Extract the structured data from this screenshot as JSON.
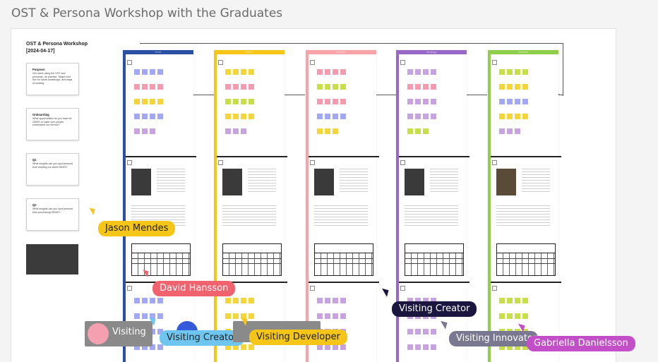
{
  "page_title": "OST & Persona Workshop with the Graduates",
  "workshop": {
    "title_line1": "OST & Persona Workshop",
    "title_line2": "[2024-04-17]",
    "cards": [
      {
        "heading": "Purpose:",
        "text": "Get users using the OST and personas, do practice. Target next five for future workshops, and ways of working"
      },
      {
        "heading": "Onboarding",
        "text": "What opportunities do you have for OEMS to make sure people understand our service?"
      },
      {
        "heading": "Q1",
        "text": "What insights can you spot persona from building our client OEMS?"
      },
      {
        "heading": "Q2",
        "text": "What insights can you spot persona from purchasing OEMS?"
      }
    ]
  },
  "columns": [
    {
      "name": "Rolls",
      "color": "#2b4fa3"
    },
    {
      "name": "Vision",
      "color": "#f5c518"
    },
    {
      "name": "Monitor",
      "color": "#f7a3a8"
    },
    {
      "name": "Strategy",
      "color": "#9868c7"
    },
    {
      "name": "Valuable",
      "color": "#8fce4a"
    }
  ],
  "sticky_colors": {
    "blue": "#a3a8f5",
    "yellow": "#f5d63a",
    "pink": "#f59bb0",
    "purple": "#c7a3e0",
    "green": "#c7e04a"
  },
  "collaborators": [
    {
      "name": "Jason Mendes",
      "color": "#f5c518",
      "text_color": "#222222"
    },
    {
      "name": "David Hansson",
      "color": "#f0626e",
      "text_color": "#ffffff"
    },
    {
      "name": "Visiting Creator",
      "color": "#1a1640",
      "text_color": "#ffffff"
    },
    {
      "name": "Visiting",
      "color": "#8a8a8a",
      "text_color": "#ffffff"
    },
    {
      "name": "Visiting Creator",
      "color": "#6ec6f0",
      "text_color": "#222222"
    },
    {
      "name": "Visiting Developer",
      "color": "#f5c518",
      "text_color": "#222222"
    },
    {
      "name": "Visiting Innovator",
      "color": "#7a7890",
      "text_color": "#ffffff"
    },
    {
      "name": "Gabriella Danielsson",
      "color": "#c24fc7",
      "text_color": "#ffffff"
    }
  ]
}
